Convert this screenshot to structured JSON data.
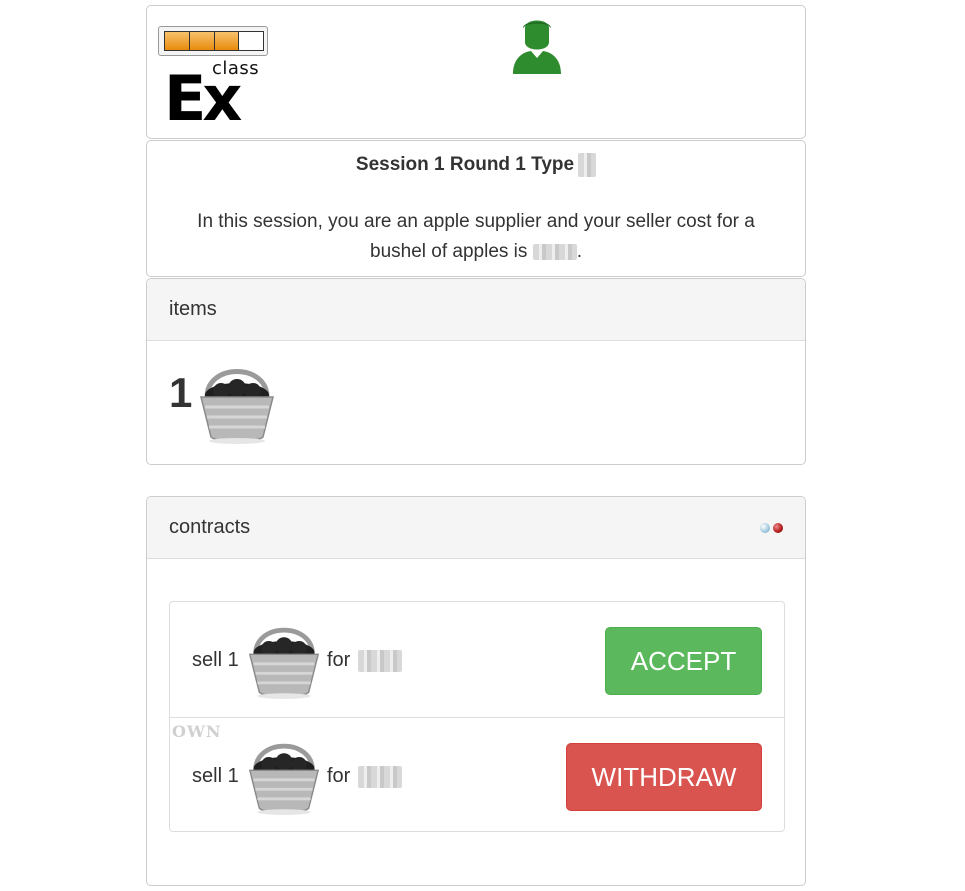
{
  "header": {
    "logo_small": "class",
    "logo_big": "Ex",
    "progress": {
      "filled": 3,
      "total": 4
    },
    "user_icon": "user-icon",
    "user_color": "#2e8b2e"
  },
  "info": {
    "title": "Session 1 Round 1 Type",
    "text_before": "In this session, you are an apple supplier and your seller cost for a bushel of apples is",
    "text_after": "."
  },
  "items": {
    "heading": "items",
    "quantity": "1",
    "icon": "apple-basket-icon"
  },
  "contracts": {
    "heading": "contracts",
    "status_colors": [
      "#9fc6dc",
      "#b01818"
    ],
    "rows": [
      {
        "sell_label": "sell 1",
        "for_label": "for",
        "own_tag": "",
        "button_label": "ACCEPT",
        "button_color": "#5cb85c"
      },
      {
        "sell_label": "sell 1",
        "for_label": "for",
        "own_tag": "OWN",
        "button_label": "WITHDRAW",
        "button_color": "#d9534f"
      }
    ]
  }
}
